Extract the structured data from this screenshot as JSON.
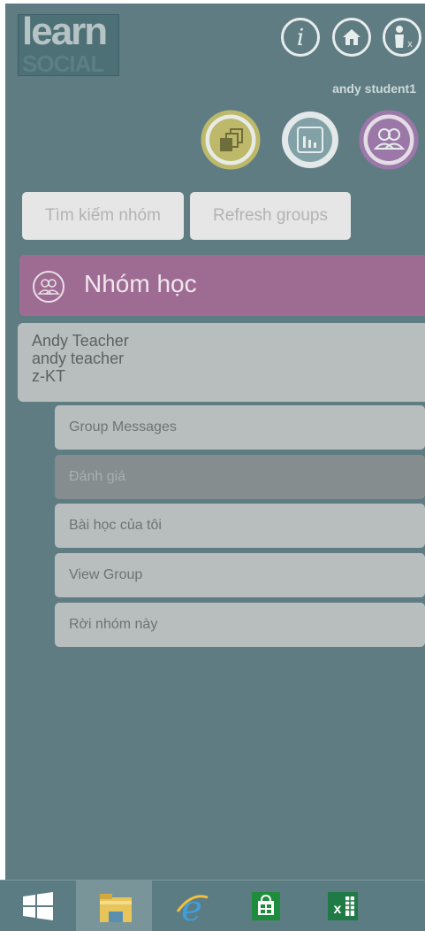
{
  "app": {
    "logo_top": "learn",
    "logo_bottom": "SOCIAL",
    "user_name": "andy student1"
  },
  "top_icons": [
    "info-icon",
    "home-icon",
    "user-remove-icon"
  ],
  "feature_icons": [
    "stacked-documents-icon",
    "bar-chart-icon",
    "group-icon"
  ],
  "buttons": {
    "search_groups": "Tìm kiếm nhóm",
    "refresh_groups": "Refresh groups"
  },
  "groups": {
    "title": "Nhóm học",
    "teacher": {
      "name": "Andy Teacher",
      "username": "andy teacher",
      "group": "z-KT"
    },
    "menu": [
      {
        "label": "Group Messages"
      },
      {
        "label": "Đánh giá",
        "active": true
      },
      {
        "label": "Bài học của tôi"
      },
      {
        "label": "View Group"
      },
      {
        "label": "Rời nhóm này"
      }
    ]
  },
  "taskbar": [
    "windows-start-icon",
    "file-explorer-icon",
    "internet-explorer-icon",
    "store-icon",
    "excel-icon"
  ],
  "colors": {
    "background": "#5e7c82",
    "groups_header": "#9e6c93",
    "yellow_ring": "#bdb86a",
    "purple_ring": "#9c78a8"
  }
}
